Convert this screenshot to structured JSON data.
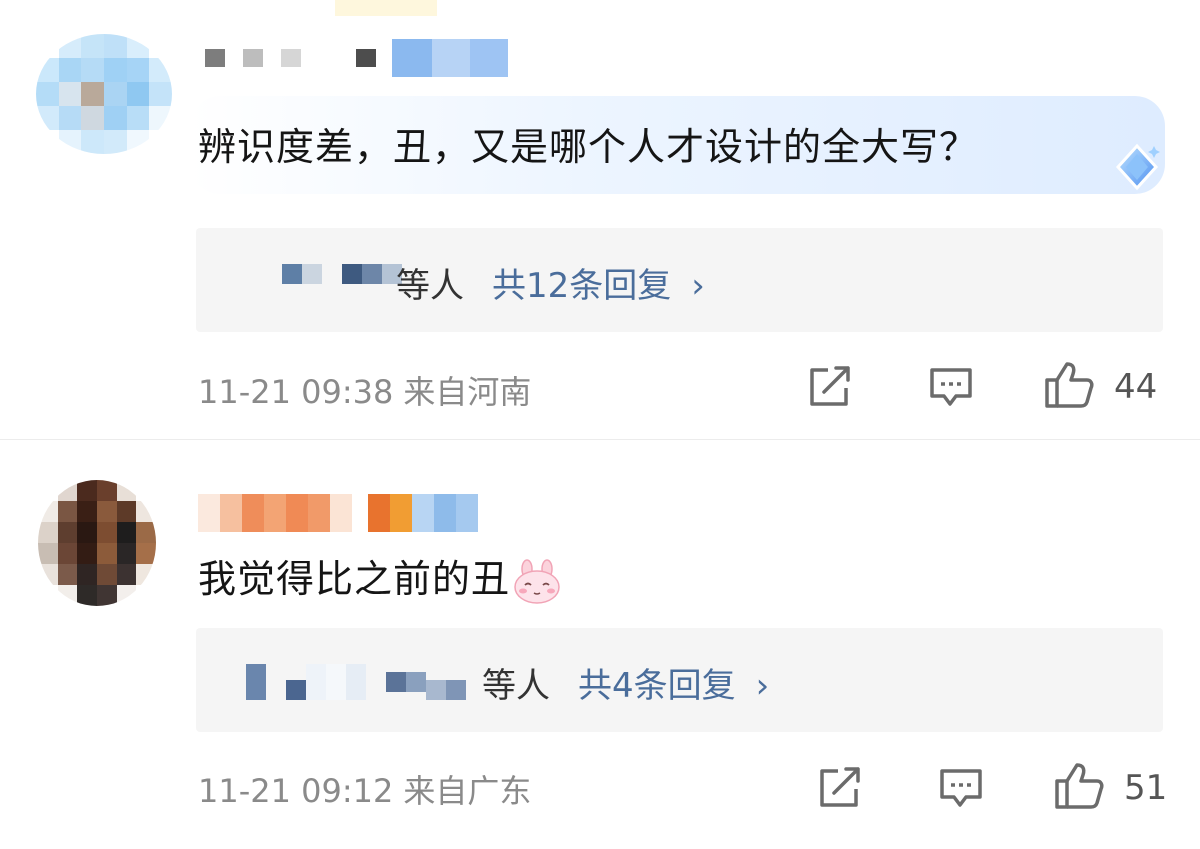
{
  "comments": [
    {
      "content": "辨识度差，丑，又是哪个人才设计的全大写？",
      "badge_icon": "diamond-badge-icon",
      "reply_summary": {
        "suffix": "等人",
        "count_label": "共12条回复",
        "chevron": "›"
      },
      "date": "11-21 09:38",
      "location": "来自河南",
      "likes": "44"
    },
    {
      "content": "我觉得比之前的丑",
      "emoji": "bunny-blush-emoji",
      "reply_summary": {
        "suffix": "等人",
        "count_label": "共4条回复",
        "chevron": "›"
      },
      "date": "11-21 09:12",
      "location": "来自广东",
      "likes": "51"
    }
  ],
  "colors": {
    "link": "#4a6d9b",
    "meta": "#8a8a8a",
    "reply_bg": "#f5f5f5"
  }
}
